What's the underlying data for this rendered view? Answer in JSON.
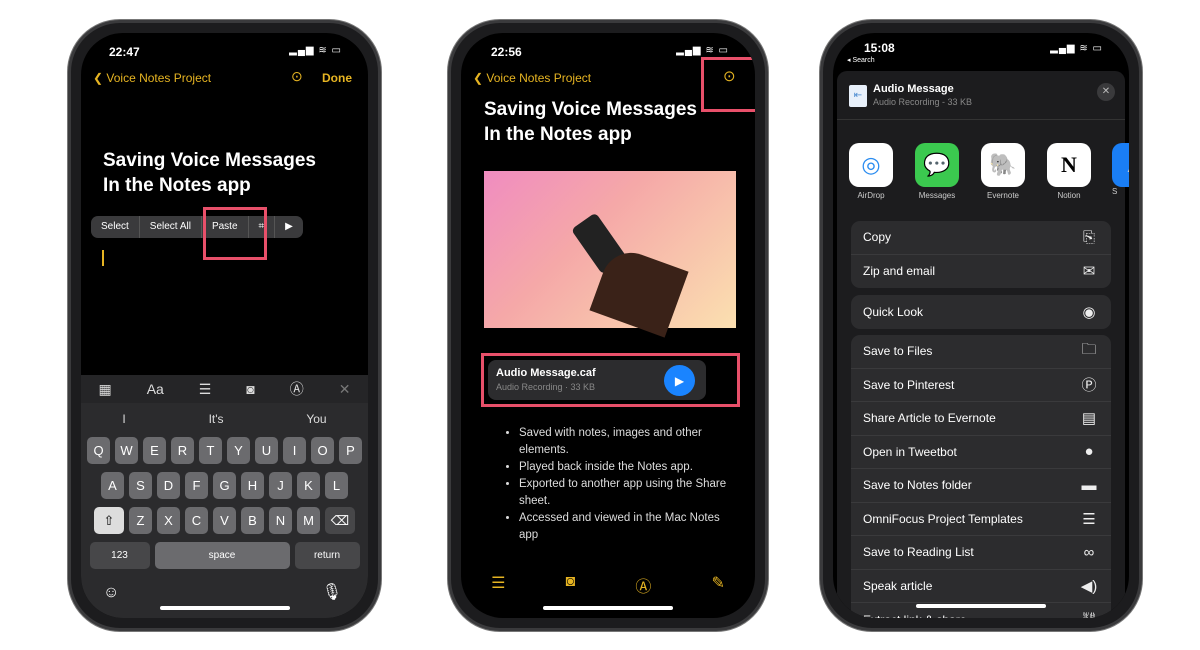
{
  "phone1": {
    "time": "22:47",
    "back": "Voice Notes Project",
    "done": "Done",
    "title_line1": "Saving Voice Messages",
    "title_line2": "In the Notes app",
    "menu": [
      "Select",
      "Select All",
      "Paste"
    ],
    "suggestions": [
      "I",
      "It's",
      "You"
    ],
    "rows": [
      [
        "Q",
        "W",
        "E",
        "R",
        "T",
        "Y",
        "U",
        "I",
        "O",
        "P"
      ],
      [
        "A",
        "S",
        "D",
        "F",
        "G",
        "H",
        "J",
        "K",
        "L"
      ],
      [
        "Z",
        "X",
        "C",
        "V",
        "B",
        "N",
        "M"
      ]
    ],
    "key_123": "123",
    "key_space": "space",
    "key_return": "return",
    "toolbar_aa": "Aa"
  },
  "phone2": {
    "time": "22:56",
    "back": "Voice Notes Project",
    "title_line1": "Saving Voice Messages",
    "title_line2": "In the Notes app",
    "attachment_name": "Audio Message.caf",
    "attachment_sub": "Audio Recording · 33 KB",
    "bullets": [
      "Saved with notes,  images and other elements.",
      "Played back inside the Notes app.",
      "Exported to another app using the Share sheet.",
      "Accessed and viewed in the Mac Notes app"
    ]
  },
  "phone3": {
    "time": "15:08",
    "back": "◂ Search",
    "file_name": "Audio Message",
    "file_sub": "Audio Recording - 33 KB",
    "apps": [
      {
        "label": "AirDrop",
        "icon": "airdrop-icon"
      },
      {
        "label": "Messages",
        "icon": "messages-icon"
      },
      {
        "label": "Evernote",
        "icon": "evernote-icon"
      },
      {
        "label": "Notion",
        "icon": "notion-icon"
      },
      {
        "label": "S",
        "icon": "app-icon"
      }
    ],
    "group1": [
      {
        "label": "Copy",
        "icon": "copy-icon"
      },
      {
        "label": "Zip and email",
        "icon": "mail-icon"
      }
    ],
    "group2": [
      {
        "label": "Quick Look",
        "icon": "eye-icon"
      }
    ],
    "group3": [
      {
        "label": "Save to Files",
        "icon": "folder-icon"
      },
      {
        "label": "Save to Pinterest",
        "icon": "pinterest-icon"
      },
      {
        "label": "Share Article to Evernote",
        "icon": "document-icon"
      },
      {
        "label": "Open in Tweetbot",
        "icon": "chat-bubble-icon"
      },
      {
        "label": "Save to Notes folder",
        "icon": "folder-filled-icon"
      },
      {
        "label": "OmniFocus Project Templates",
        "icon": "list-icon"
      },
      {
        "label": "Save to Reading List",
        "icon": "glasses-icon"
      },
      {
        "label": "Speak article",
        "icon": "speaker-icon"
      },
      {
        "label": "Extract link & share",
        "icon": "link-icon"
      }
    ]
  },
  "colors": {
    "accent": "#e6b422",
    "highlight": "#e8506a",
    "play": "#1a84ff"
  }
}
